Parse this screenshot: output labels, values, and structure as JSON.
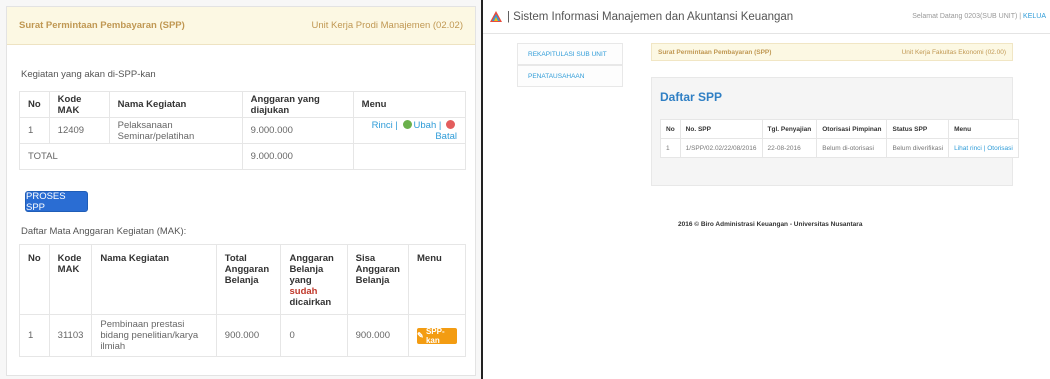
{
  "left": {
    "header": {
      "title": "Surat Permintaan Pembayaran (SPP)",
      "unit": "Unit Kerja Prodi Manajemen (02.02)"
    },
    "kegiatan_label": "Kegiatan yang akan di-SPP-kan",
    "kegiatan_table": {
      "headers": [
        "No",
        "Kode MAK",
        "Nama Kegiatan",
        "Anggaran yang diajukan",
        "Menu"
      ],
      "row": {
        "no": "1",
        "kode": "12409",
        "nama": "Pelaksanaan Seminar/pelatihan",
        "anggaran": "9.000.000"
      },
      "menu": {
        "rinci": "Rinci",
        "sep1": "|",
        "ubah": "Ubah",
        "sep2": "|",
        "batal": "Batal"
      },
      "total_label": "TOTAL",
      "total_value": "9.000.000"
    },
    "proses_button": "PROSES SPP",
    "mak_label": "Daftar Mata Anggaran Kegiatan (MAK):",
    "mak_table": {
      "h_no": "No",
      "h_kode": "Kode MAK",
      "h_nama": "Nama Kegiatan",
      "h_total": "Total Anggaran Belanja",
      "h_anggaran_pre": "Anggaran Belanja yang",
      "h_anggaran_red": "sudah",
      "h_anggaran_post": "dicairkan",
      "h_sisa": "Sisa Anggaran Belanja",
      "h_menu": "Menu",
      "row": {
        "no": "1",
        "kode": "31103",
        "nama": "Pembinaan prestasi bidang penelitian/karya ilmiah",
        "total": "900.000",
        "dicairkan": "0",
        "sisa": "900.000"
      },
      "spp_button": "SPP-kan"
    }
  },
  "right": {
    "app_title": "| Sistem Informasi Manajemen dan Akuntansi Keuangan",
    "welcome": "Selamat Datang 0203(SUB UNIT)",
    "sep": "|",
    "logout": "KELUA",
    "nav": [
      "REKAPITULASI SUB UNIT",
      "PENATAUSAHAAN"
    ],
    "crumb": {
      "title": "Surat Permintaan Pembayaran (SPP)",
      "unit": "Unit Kerja Fakultas Ekonomi (02.00)"
    },
    "card_title": "Daftar SPP",
    "table": {
      "headers": [
        "No",
        "No. SPP",
        "Tgl. Penyajian",
        "Otorisasi Pimpinan",
        "Status SPP",
        "Menu"
      ],
      "row": {
        "no": "1",
        "no_spp": "1/SPP/02.02/22/08/2016",
        "tgl": "22-08-2016",
        "otorisasi": "Belum di-otorisasi",
        "status": "Belum diverifikasi",
        "lihat": "Lihat rinci",
        "sep": "|",
        "otorisasi_link": "Otorisasi"
      }
    },
    "footer": "2016 © Biro Administrasi Keuangan - Universitas Nusantara"
  }
}
